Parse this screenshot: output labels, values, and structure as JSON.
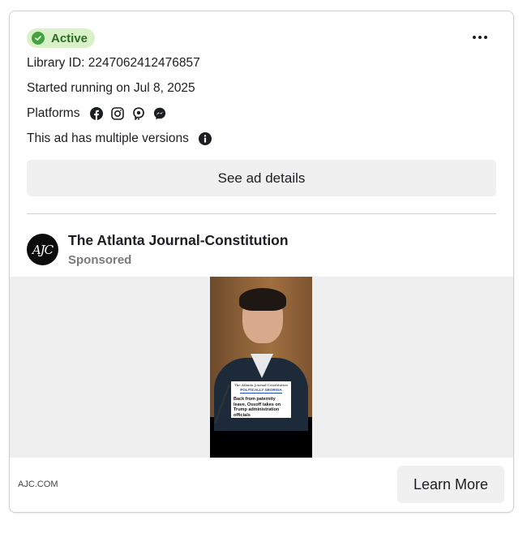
{
  "status": {
    "label": "Active",
    "color": "#43a33f"
  },
  "library_id": "Library ID: 2247062412476857",
  "started": "Started running on Jul 8, 2025",
  "platforms": {
    "label": "Platforms",
    "icons": [
      "facebook-icon",
      "instagram-icon",
      "audience-network-icon",
      "messenger-icon"
    ]
  },
  "versions_note": "This ad has multiple versions",
  "details_button": "See ad details",
  "advertiser": {
    "name": "The Atlanta Journal-Constitution",
    "sponsored": "Sponsored",
    "avatar_text": "AJC"
  },
  "creative": {
    "masthead": "The Atlanta Journal-Constitution",
    "section": "POLITICALLY GEORGIA",
    "headline": "Back from paternity leave, Ossoff takes on Trump administration officials"
  },
  "footer": {
    "domain": "AJC.COM",
    "cta": "Learn More"
  }
}
